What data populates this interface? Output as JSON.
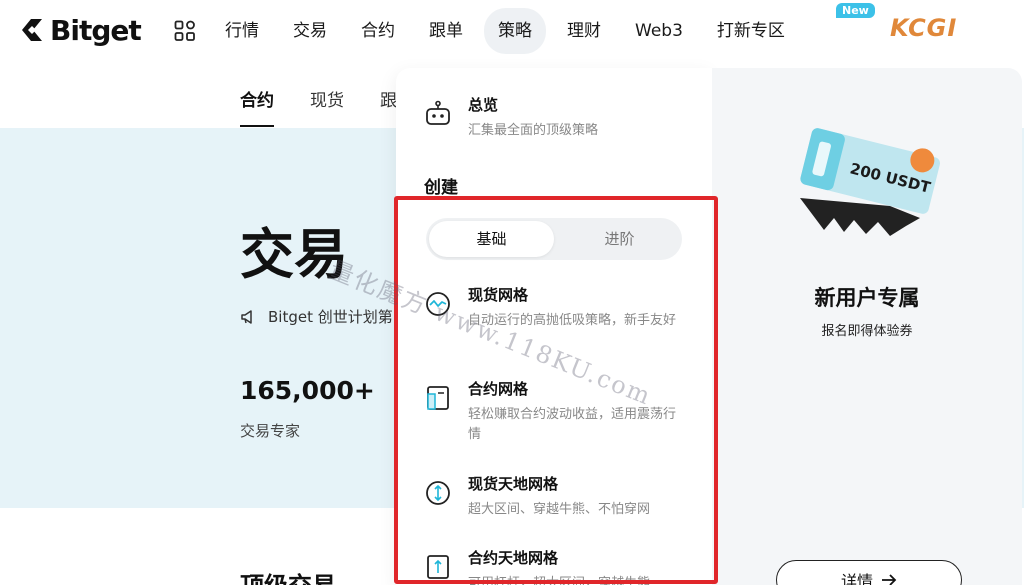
{
  "logo": {
    "name": "Bitget"
  },
  "nav": {
    "items": [
      {
        "label": "行情"
      },
      {
        "label": "交易"
      },
      {
        "label": "合约"
      },
      {
        "label": "跟单"
      },
      {
        "label": "策略",
        "active": true
      },
      {
        "label": "理财"
      },
      {
        "label": "Web3"
      },
      {
        "label": "打新专区"
      }
    ],
    "new_badge": "New",
    "partner_logo": "KCGI"
  },
  "page": {
    "subtabs": [
      {
        "label": "合约",
        "active": true
      },
      {
        "label": "现货"
      },
      {
        "label": "跟"
      }
    ],
    "hero_title": "交易",
    "hero_note": "Bitget 创世计划第",
    "stat_value": "165,000+",
    "stat_label": "交易专家",
    "bottom_heading": "顶级交易"
  },
  "dropdown": {
    "overview": {
      "title": "总览",
      "desc": "汇集最全面的顶级策略",
      "icon": "robot-icon"
    },
    "create_title": "创建",
    "segments": [
      {
        "label": "基础",
        "active": true
      },
      {
        "label": "进阶"
      }
    ],
    "items": [
      {
        "title": "现货网格",
        "desc": "自动运行的高抛低吸策略，新手友好",
        "icon": "spot-grid-icon"
      },
      {
        "title": "合约网格",
        "desc": "轻松赚取合约波动收益，适用震荡行情",
        "icon": "futures-grid-icon"
      },
      {
        "title": "现货天地网格",
        "desc": "超大区间、穿越牛熊、不怕穿网",
        "icon": "infinity-grid-icon"
      },
      {
        "title": "合约天地网格",
        "desc": "可用杠杆，超大区间，穿越牛熊",
        "icon": "futures-infinity-grid-icon"
      }
    ]
  },
  "promo": {
    "ticket_text": "200 USDT",
    "title": "新用户专属",
    "subtitle": "报名即得体验券",
    "details_label": "详情"
  },
  "watermark": "量化魔方 www.118KU.com",
  "colors": {
    "highlight": "#e0262a",
    "accent": "#3cc1e8",
    "hero_bg": "#e6f3f8"
  }
}
